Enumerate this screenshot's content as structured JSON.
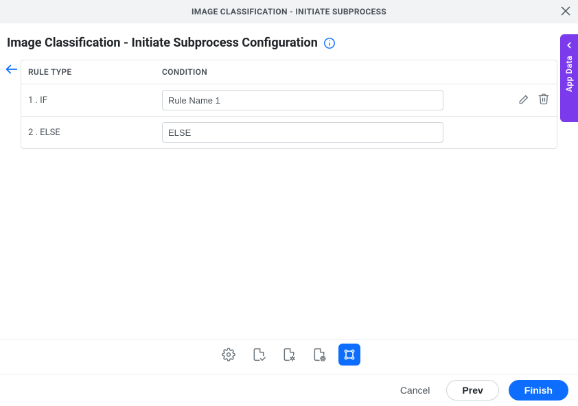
{
  "header": {
    "modal_title": "IMAGE CLASSIFICATION - INITIATE SUBPROCESS"
  },
  "page": {
    "title": "Image Classification - Initiate Subprocess Configuration"
  },
  "table": {
    "headers": {
      "rule_type": "RULE TYPE",
      "condition": "CONDITION"
    },
    "rows": [
      {
        "rule_type": "1 . IF",
        "condition": "Rule Name 1",
        "editable": true
      },
      {
        "rule_type": "2 . ELSE",
        "condition": "ELSE",
        "editable": false
      }
    ]
  },
  "side_tab": {
    "label": "App Data"
  },
  "footer": {
    "cancel": "Cancel",
    "prev": "Prev",
    "finish": "Finish"
  }
}
